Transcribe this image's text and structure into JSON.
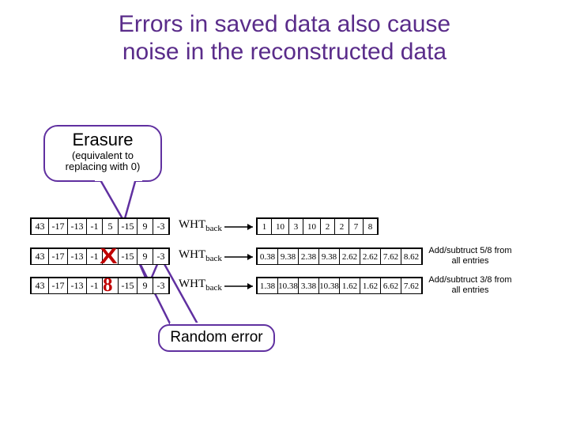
{
  "title_line1": "Errors in saved data also cause",
  "title_line2": "noise in the reconstructed data",
  "erasure": {
    "title": "Erasure",
    "sub1": "(equivalent to",
    "sub2": "replacing with 0)"
  },
  "random_label": "Random error",
  "wht_label_html": "WHT<sub>back</sub>",
  "marks": {
    "x": "X",
    "eight": "8"
  },
  "rows": [
    {
      "left": [
        "43",
        "-17",
        "-13",
        "-1",
        "5",
        "-15",
        "9",
        "-3"
      ],
      "right": [
        "1",
        "10",
        "3",
        "10",
        "2",
        "2",
        "7",
        "8"
      ],
      "note": ""
    },
    {
      "left": [
        "43",
        "-17",
        "-13",
        "-1",
        "",
        "-15",
        "9",
        "-3"
      ],
      "right": [
        "0.38",
        "9.38",
        "2.38",
        "9.38",
        "2.62",
        "2.62",
        "7.62",
        "8.62"
      ],
      "note": "Add/subtruct 5/8 from all entries"
    },
    {
      "left": [
        "43",
        "-17",
        "-13",
        "-1",
        "",
        "-15",
        "9",
        "-3"
      ],
      "right": [
        "1.38",
        "10.38",
        "3.38",
        "10.38",
        "1.62",
        "1.62",
        "6.62",
        "7.62"
      ],
      "note": "Add/subtruct 3/8 from all entries"
    }
  ],
  "layout": {
    "left_widths": [
      22,
      24,
      24,
      20,
      20,
      24,
      20,
      20
    ],
    "right_widths_row0": [
      18,
      22,
      18,
      22,
      18,
      18,
      18,
      18
    ],
    "right_widths_rowN": [
      26,
      26,
      26,
      26,
      26,
      26,
      26,
      26
    ]
  }
}
